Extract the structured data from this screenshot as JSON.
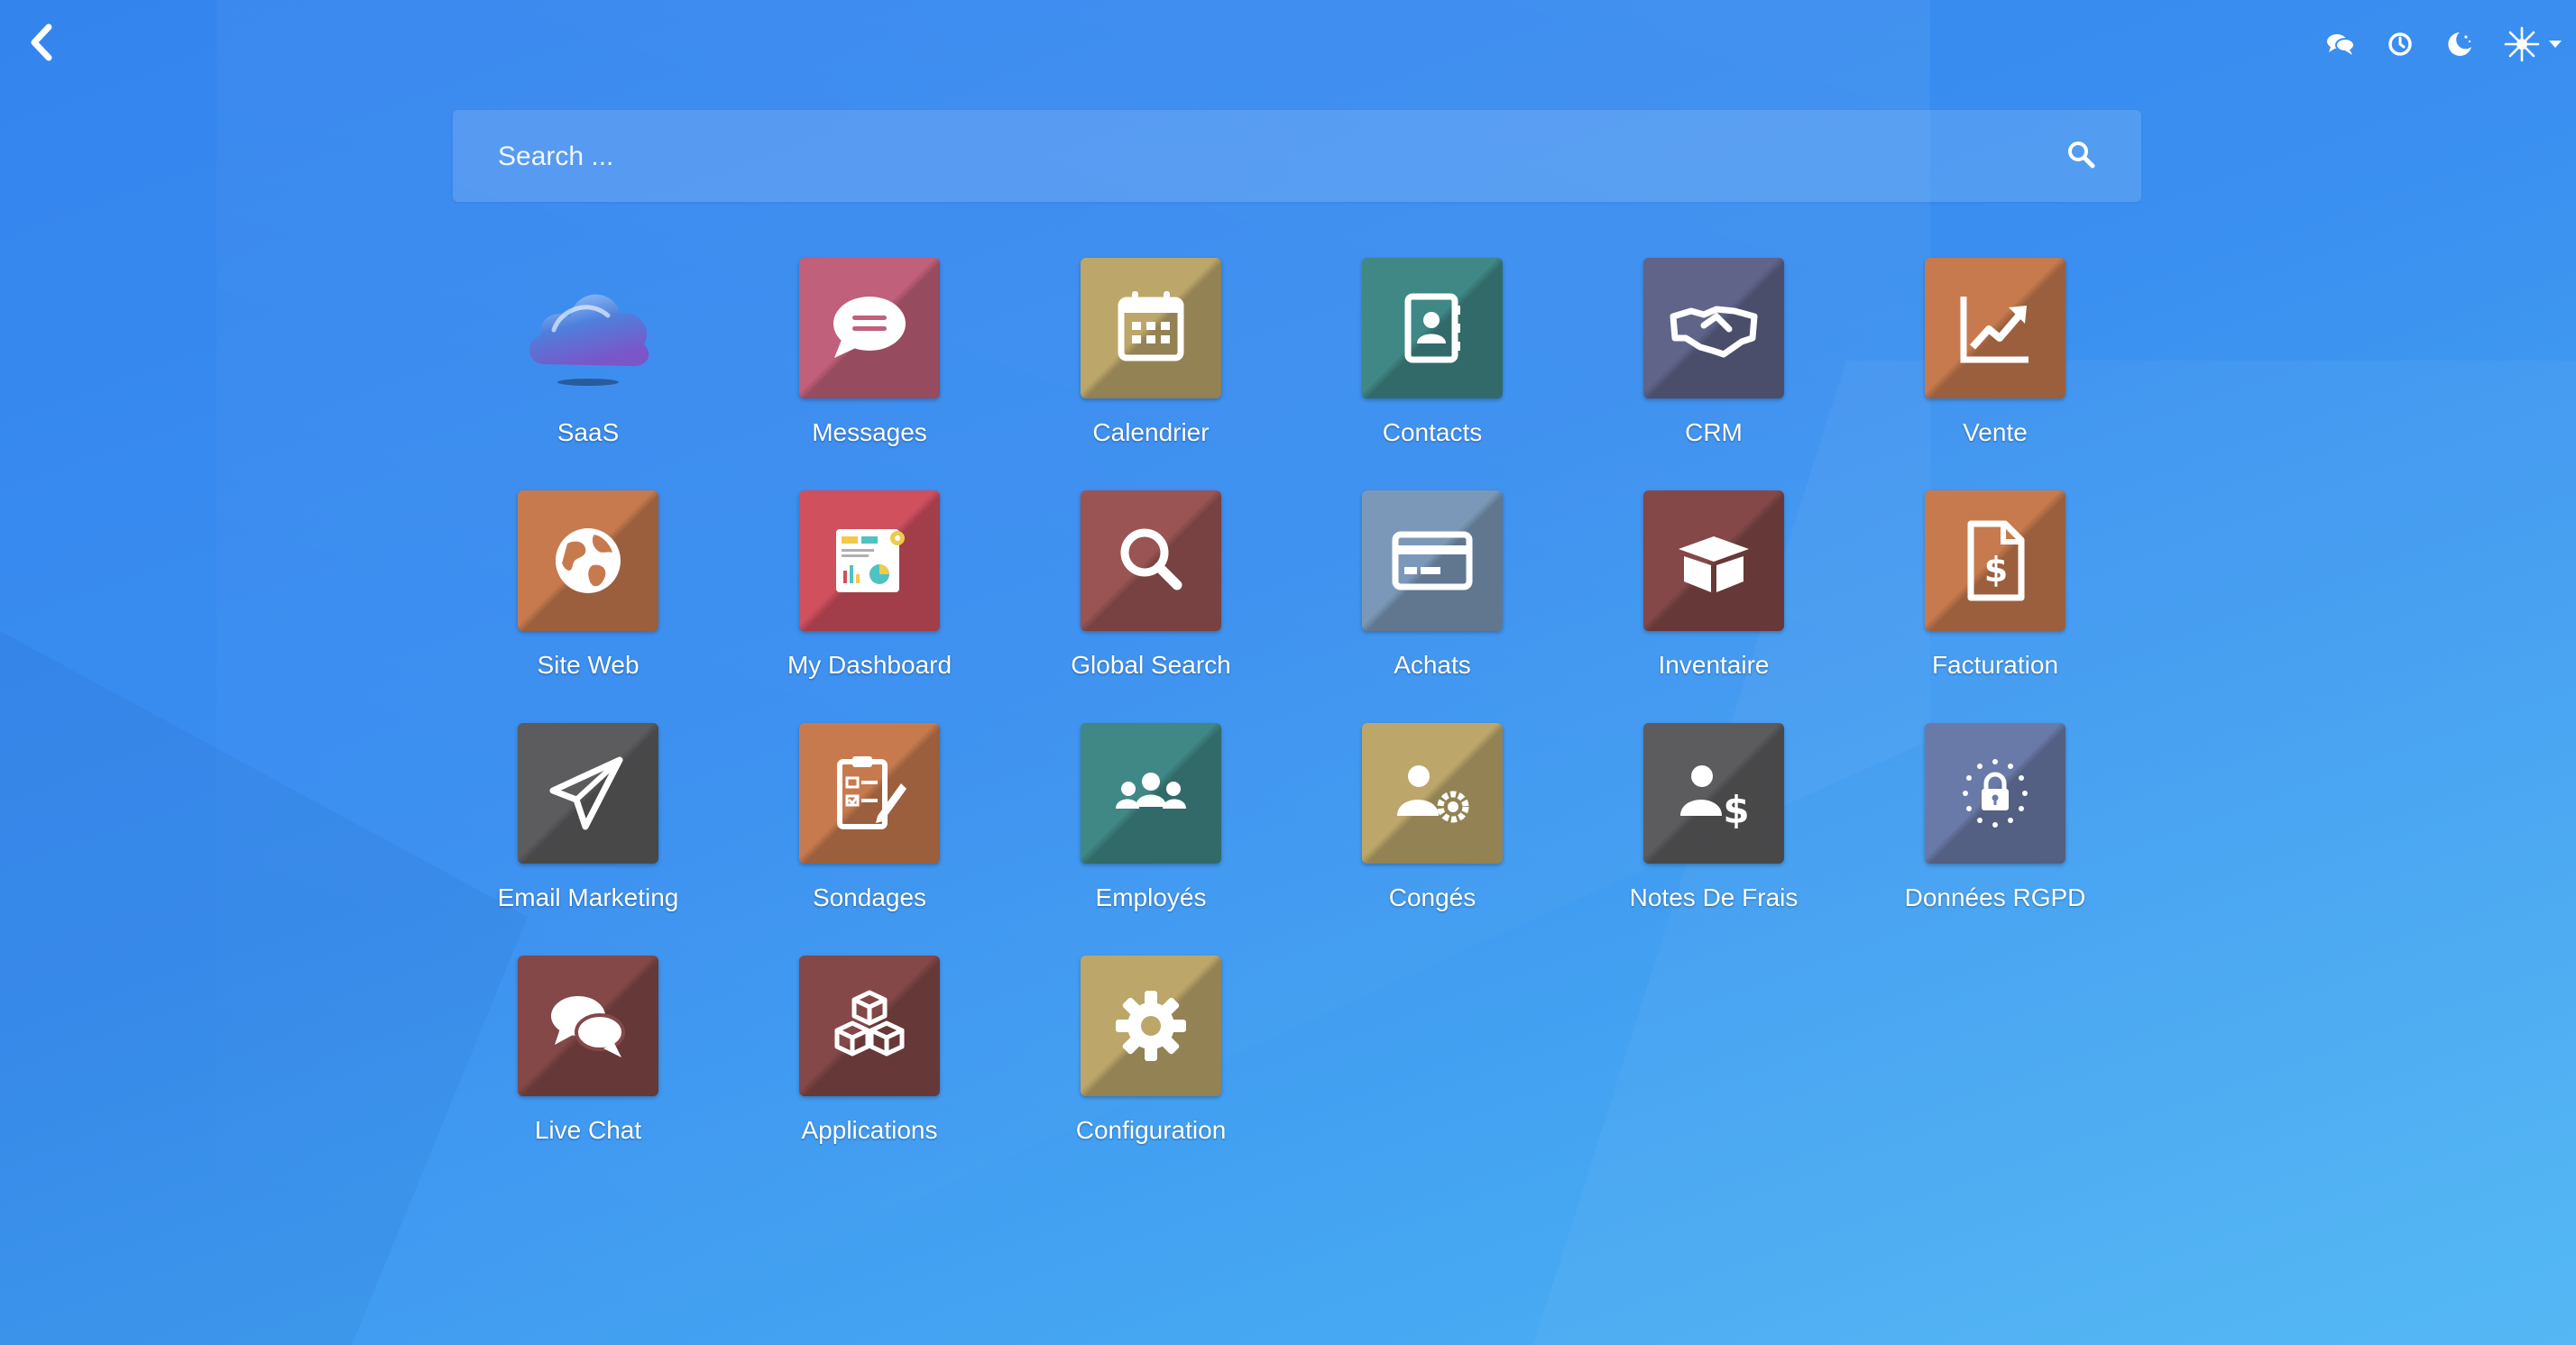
{
  "search": {
    "placeholder": "Search ..."
  },
  "topbar": {
    "back": "back-arrow-icon",
    "systray": [
      "chat-icon",
      "clock-icon",
      "moon-icon",
      "company-logo-icon",
      "caret-down-icon"
    ]
  },
  "apps": [
    {
      "label": "SaaS",
      "icon": "cloud-icon",
      "color": "#5a86d6"
    },
    {
      "label": "Messages",
      "icon": "chat-bubble-icon",
      "color": "#c0607a"
    },
    {
      "label": "Calendrier",
      "icon": "calendar-icon",
      "color": "#bca66a"
    },
    {
      "label": "Contacts",
      "icon": "address-book-icon",
      "color": "#3f8886"
    },
    {
      "label": "CRM",
      "icon": "handshake-icon",
      "color": "#5f6488"
    },
    {
      "label": "Vente",
      "icon": "trending-up-chart-icon",
      "color": "#c77a4e"
    },
    {
      "label": "Site Web",
      "icon": "globe-icon",
      "color": "#c77a4e"
    },
    {
      "label": "My Dashboard",
      "icon": "dashboard-icon",
      "color": "#d0505e"
    },
    {
      "label": "Global Search",
      "icon": "magnifier-icon",
      "color": "#9a5454"
    },
    {
      "label": "Achats",
      "icon": "credit-card-icon",
      "color": "#7c98b8"
    },
    {
      "label": "Inventaire",
      "icon": "box-icon",
      "color": "#844848"
    },
    {
      "label": "Facturation",
      "icon": "invoice-dollar-icon",
      "color": "#c77a4e"
    },
    {
      "label": "Email Marketing",
      "icon": "paper-plane-icon",
      "color": "#5c5c5e"
    },
    {
      "label": "Sondages",
      "icon": "survey-checklist-icon",
      "color": "#c77a4e"
    },
    {
      "label": "Employés",
      "icon": "people-group-icon",
      "color": "#3f8886"
    },
    {
      "label": "Congés",
      "icon": "user-gear-icon",
      "color": "#bca66a"
    },
    {
      "label": "Notes De Frais",
      "icon": "user-dollar-icon",
      "color": "#5c5c5e"
    },
    {
      "label": "Données RGPD",
      "icon": "eu-lock-icon",
      "color": "#6a7aa8"
    },
    {
      "label": "Live Chat",
      "icon": "chat-bubbles-icon",
      "color": "#844848"
    },
    {
      "label": "Applications",
      "icon": "cubes-icon",
      "color": "#844848"
    },
    {
      "label": "Configuration",
      "icon": "gear-icon",
      "color": "#bca66a"
    }
  ]
}
